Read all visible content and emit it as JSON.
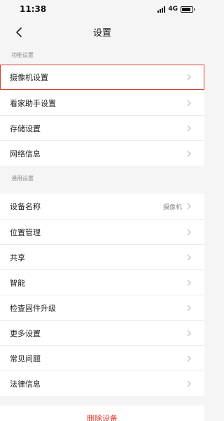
{
  "status_bar": {
    "time": "11:38",
    "network": "4G",
    "battery_level": 0.85
  },
  "nav": {
    "title": "设置"
  },
  "sections": {
    "function_header": "功能设置",
    "general_header": "通用设置"
  },
  "function_items": [
    {
      "label": "摄像机设置",
      "selected": true
    },
    {
      "label": "看家助手设置"
    },
    {
      "label": "存储设置"
    },
    {
      "label": "网络信息"
    }
  ],
  "general_items": [
    {
      "label": "设备名称",
      "value": "摄像机"
    },
    {
      "label": "位置管理"
    },
    {
      "label": "共享"
    },
    {
      "label": "智能"
    },
    {
      "label": "检查固件升级"
    },
    {
      "label": "更多设置"
    },
    {
      "label": "常见问题"
    },
    {
      "label": "法律信息"
    }
  ],
  "delete_label": "删除设备",
  "colors": {
    "highlight": "#e23b30",
    "delete_text": "#e0302a",
    "background": "#f5f5f5"
  },
  "icons": {
    "back": "chevron-left-icon",
    "row_arrow": "chevron-right-icon"
  }
}
